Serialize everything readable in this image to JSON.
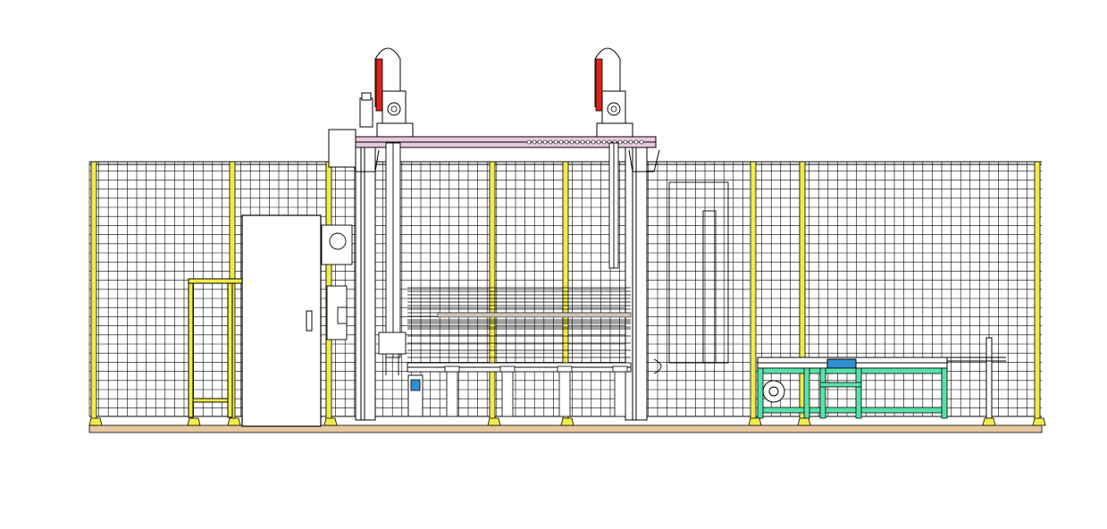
{
  "drawing": {
    "kind": "CAD front elevation of an automated gantry cell enclosed by mesh safety fencing",
    "colors": {
      "background": "#ffffff",
      "line": "#000000",
      "post_yellow": "#f2ec4a",
      "floor": "#e8c7a0",
      "gantry_beam": "#e7c9df",
      "cable_carrier_red": "#e0201c",
      "conveyor_frame_green": "#57e3a8",
      "sensor_blue": "#2f8fd0",
      "door_fill": "#ffffff"
    },
    "icons": [
      "gear-motor-icon",
      "cable-carrier-icon",
      "fan-motor-icon",
      "door-handle-icon"
    ]
  }
}
